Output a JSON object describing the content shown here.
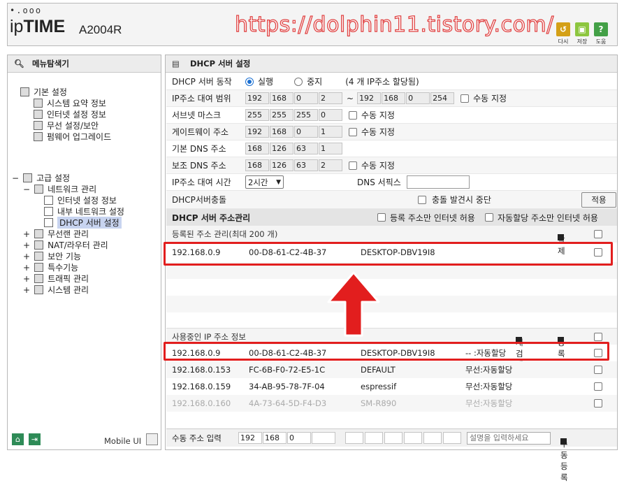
{
  "header": {
    "logo_dots": "•.ooo",
    "logo_ip": "ip",
    "logo_time": "TIME",
    "model": "A2004R",
    "watermark": "https://dolphin11.tistory.com/",
    "buttons": [
      {
        "label": "다시",
        "color": "#d4a017"
      },
      {
        "label": "저장",
        "color": "#8dc63f"
      },
      {
        "label": "도움",
        "color": "#43a047"
      }
    ]
  },
  "left": {
    "title": "메뉴탐색기",
    "mobile_ui": "Mobile UI",
    "basic": {
      "label": "기본 설정",
      "items": [
        "시스템 요약 정보",
        "인터넷 설정 정보",
        "무선 설정/보안",
        "펌웨어 업그레이드"
      ]
    },
    "advanced": {
      "label": "고급 설정",
      "network": "네트워크 관리",
      "network_items": [
        "인터넷 설정 정보",
        "내부 네트워크 설정",
        "DHCP 서버 설정"
      ],
      "others": [
        "무선랜 관리",
        "NAT/라우터 관리",
        "보안 기능",
        "특수기능",
        "트래픽 관리",
        "시스템 관리"
      ]
    }
  },
  "dhcp": {
    "title": "DHCP 서버 설정",
    "server": {
      "label": "DHCP 서버 동작",
      "run": "실행",
      "stop": "중지",
      "note": "(4 개 IP주소 할당됨)"
    },
    "range": {
      "label": "IP주소 대여 범위",
      "start": [
        "192",
        "168",
        "0",
        "2"
      ],
      "end": [
        "192",
        "168",
        "0",
        "254"
      ],
      "tilde": "~",
      "auto": "수동 지정"
    },
    "subnet": {
      "label": "서브넷 마스크",
      "value": [
        "255",
        "255",
        "255",
        "0"
      ],
      "auto": "수동 지정"
    },
    "gateway": {
      "label": "게이트웨이 주소",
      "value": [
        "192",
        "168",
        "0",
        "1"
      ],
      "auto": "수동 지정"
    },
    "dns1": {
      "label": "기본 DNS 주소",
      "value": [
        "168",
        "126",
        "63",
        "1"
      ]
    },
    "dns2": {
      "label": "보조 DNS 주소",
      "value": [
        "168",
        "126",
        "63",
        "2"
      ],
      "auto": "수동 지정"
    },
    "lease": {
      "label": "IP주소 대여 시간",
      "value": "2시간",
      "dns_suffix": "DNS 서픽스"
    },
    "conflict": {
      "label": "DHCP서버충돌",
      "stop": "충돌 발견시 중단",
      "apply": "적용"
    }
  },
  "addr_mgmt": {
    "title": "DHCP 서버 주소관리",
    "opt1": "등록 주소만 인터넷 허용",
    "opt2": "자동할당 주소만 인터넷 허용",
    "registered_label": "등록된 주소 관리(최대 200 개)",
    "delete": "삭제",
    "registered": [
      {
        "ip": "192.168.0.9",
        "mac": "00-D8-61-C2-4B-37",
        "name": "DESKTOP-DBV19I8"
      }
    ]
  },
  "in_use": {
    "label": "사용중인 IP 주소 정보",
    "rescan": "재검색",
    "register": "등록",
    "rows": [
      {
        "ip": "192.168.0.9",
        "mac": "00-D8-61-C2-4B-37",
        "name": "DESKTOP-DBV19I8",
        "type": "-- :자동할당"
      },
      {
        "ip": "192.168.0.153",
        "mac": "FC-6B-F0-72-E5-1C",
        "name": "DEFAULT",
        "type": "무선:자동할당"
      },
      {
        "ip": "192.168.0.159",
        "mac": "34-AB-95-78-7F-04",
        "name": "espressif",
        "type": "무선:자동할당"
      },
      {
        "ip": "192.168.0.160",
        "mac": "4A-73-64-5D-F4-D3",
        "name": "SM-R890",
        "type": "무선:자동할당"
      }
    ]
  },
  "manual": {
    "label": "수동 주소 입력",
    "ip": [
      "192",
      "168",
      "0",
      ""
    ],
    "desc_placeholder": "설명을 입력하세요",
    "register": "수동 등록"
  }
}
